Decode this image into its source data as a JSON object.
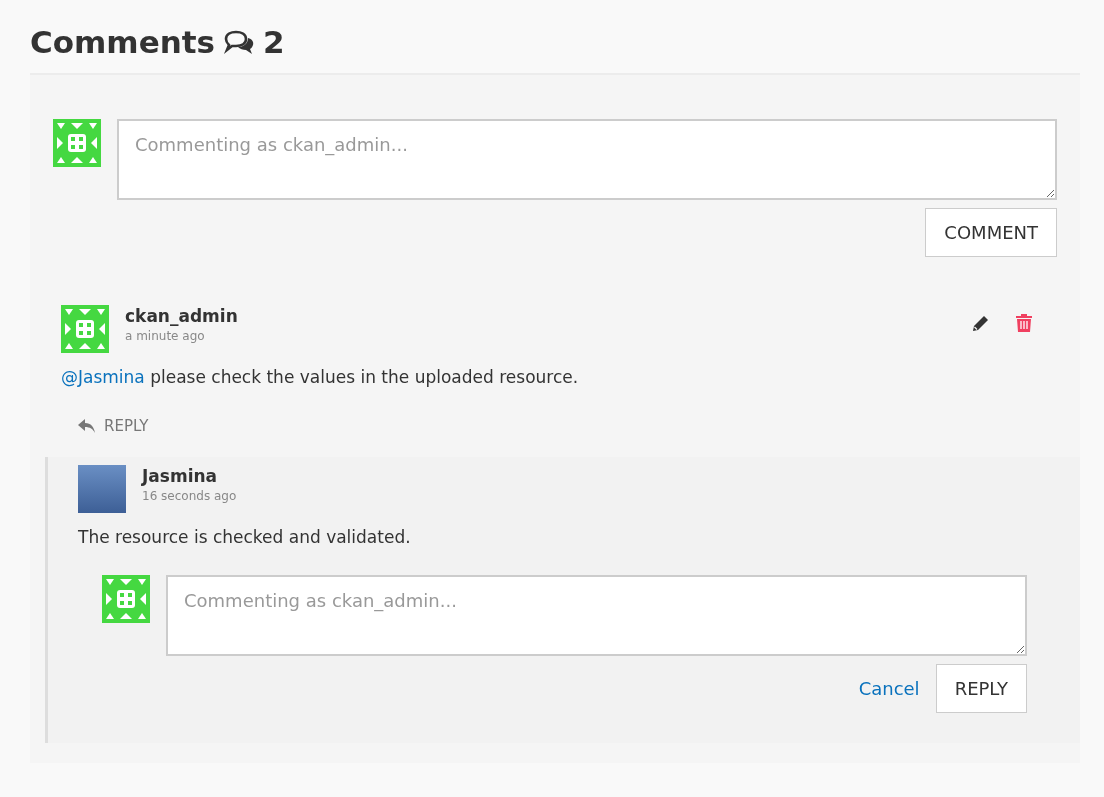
{
  "heading": {
    "title": "Comments",
    "count": "2"
  },
  "new_comment": {
    "placeholder": "Commenting as ckan_admin...",
    "button": "COMMENT"
  },
  "comments": [
    {
      "author": "ckan_admin",
      "time": "a minute ago",
      "kind": "identicon",
      "mention": "@Jasmina",
      "text": "please check the values in the uploaded resource.",
      "reply_label": "REPLY",
      "replies": [
        {
          "author": "Jasmina",
          "time": "16 seconds ago",
          "kind": "photo",
          "text": "The resource is checked and validated."
        }
      ],
      "reply_form": {
        "placeholder": "Commenting as ckan_admin...",
        "cancel": "Cancel",
        "button": "REPLY"
      }
    }
  ]
}
